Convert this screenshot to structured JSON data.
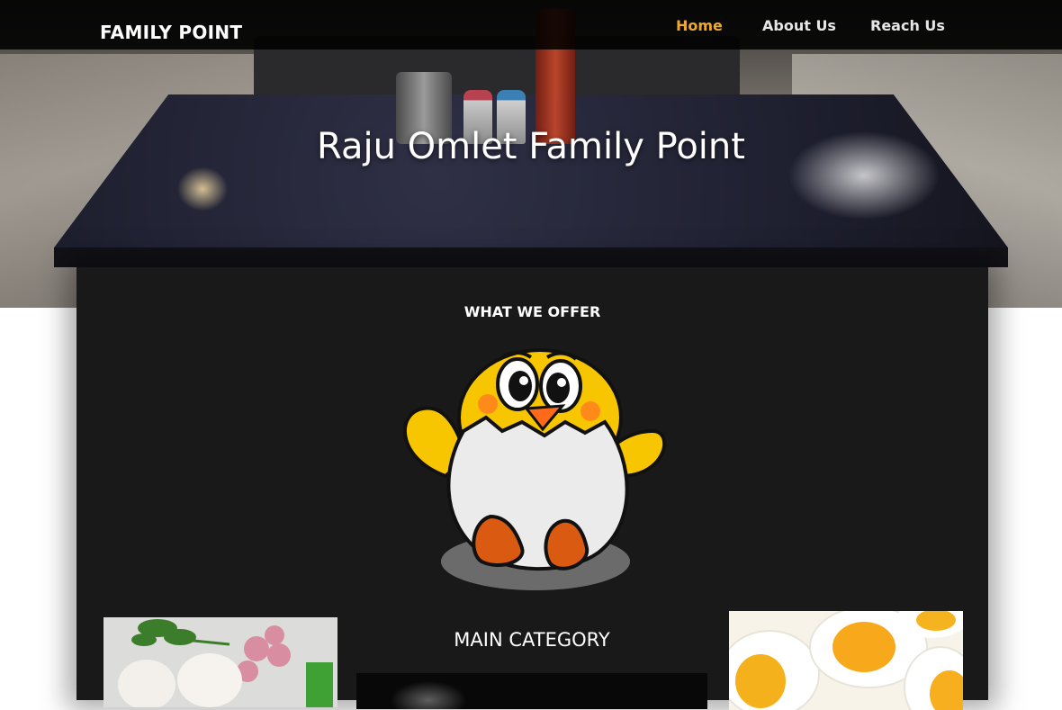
{
  "navbar": {
    "brand": "FAMILY POINT",
    "links": [
      {
        "label": "Home",
        "active": true
      },
      {
        "label": "About Us",
        "active": false
      },
      {
        "label": "Reach Us",
        "active": false
      }
    ]
  },
  "hero": {
    "title": "Raju Omlet Family Point"
  },
  "offer": {
    "title": "WHAT WE OFFER",
    "mascot_icon": "cartoon-chick-in-eggshell"
  },
  "category": {
    "title": "MAIN CATEGORY"
  },
  "images": {
    "left": "eggs-onion-vegetables-photo",
    "right": "boiled-egg-halves-photo",
    "center": "smoke-photo"
  },
  "colors": {
    "nav_bg": "#000000",
    "active_link": "#f0a92d",
    "card_bg": "#191919"
  }
}
